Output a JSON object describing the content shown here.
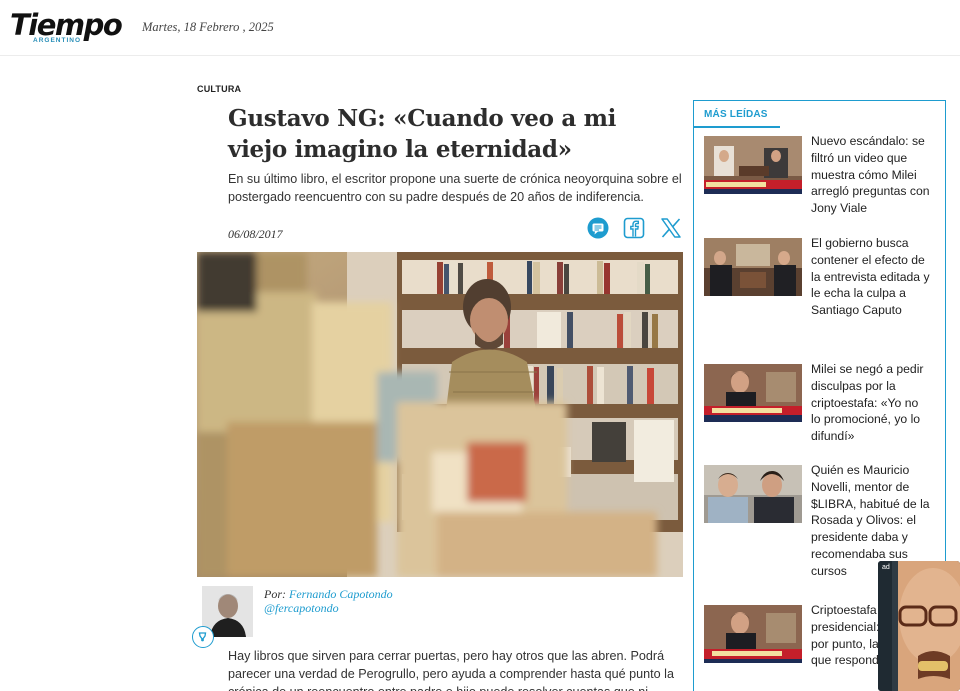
{
  "header": {
    "logo_text": "Tiempo",
    "logo_subtitle": "ARGENTINO",
    "date": "Martes, 18 Febrero , 2025"
  },
  "article": {
    "section": "CULTURA",
    "title": "Gustavo NG: «Cuando veo a mi viejo imagino la eternidad»",
    "subtitle": "En su último libro, el escritor propone una suerte de crónica neoyorquina sobre el postergado reencuentro con su padre después de 20 años de indiferencia.",
    "date": "06/08/2017",
    "share_icons": [
      "comment-icon",
      "facebook-icon",
      "x-twitter-icon"
    ],
    "author": {
      "by_label": "Por:",
      "name": "Fernando Capotondo",
      "handle": "@fercapotondo"
    },
    "body": "Hay libros que sirven para cerrar puertas, pero hay otros que las abren. Podrá parecer una verdad de Perogrullo, pero ayuda a comprender hasta qué punto la crónica de un reencuentro entre padre e hijo puede resolver cuentas que ni siquiera"
  },
  "sidebar": {
    "title": "MÁS LEÍDAS",
    "items": [
      {
        "text": "Nuevo escándalo: se filtró un video que muestra cómo Milei arregló preguntas con Jony Viale"
      },
      {
        "text": "El gobierno busca contener el efecto de la entrevista editada y le echa la culpa a Santiago Caputo"
      },
      {
        "text": "Milei se negó a pedir disculpas por la criptoestafa: «Yo no lo promocioné, yo lo difundí»"
      },
      {
        "text": "Quién es Mauricio Novelli, mentor de $LIBRA, habitué de la Rosada y Olivos: el presidente daba y recomendaba sus cursos"
      },
      {
        "text": "Criptoestafa presidencial: punto por punto, las falacias que respondió M"
      }
    ]
  },
  "ad": {
    "label": "ad"
  },
  "colors": {
    "accent": "#1e9ccf",
    "text": "#222222",
    "headline": "#2d2d2d"
  }
}
